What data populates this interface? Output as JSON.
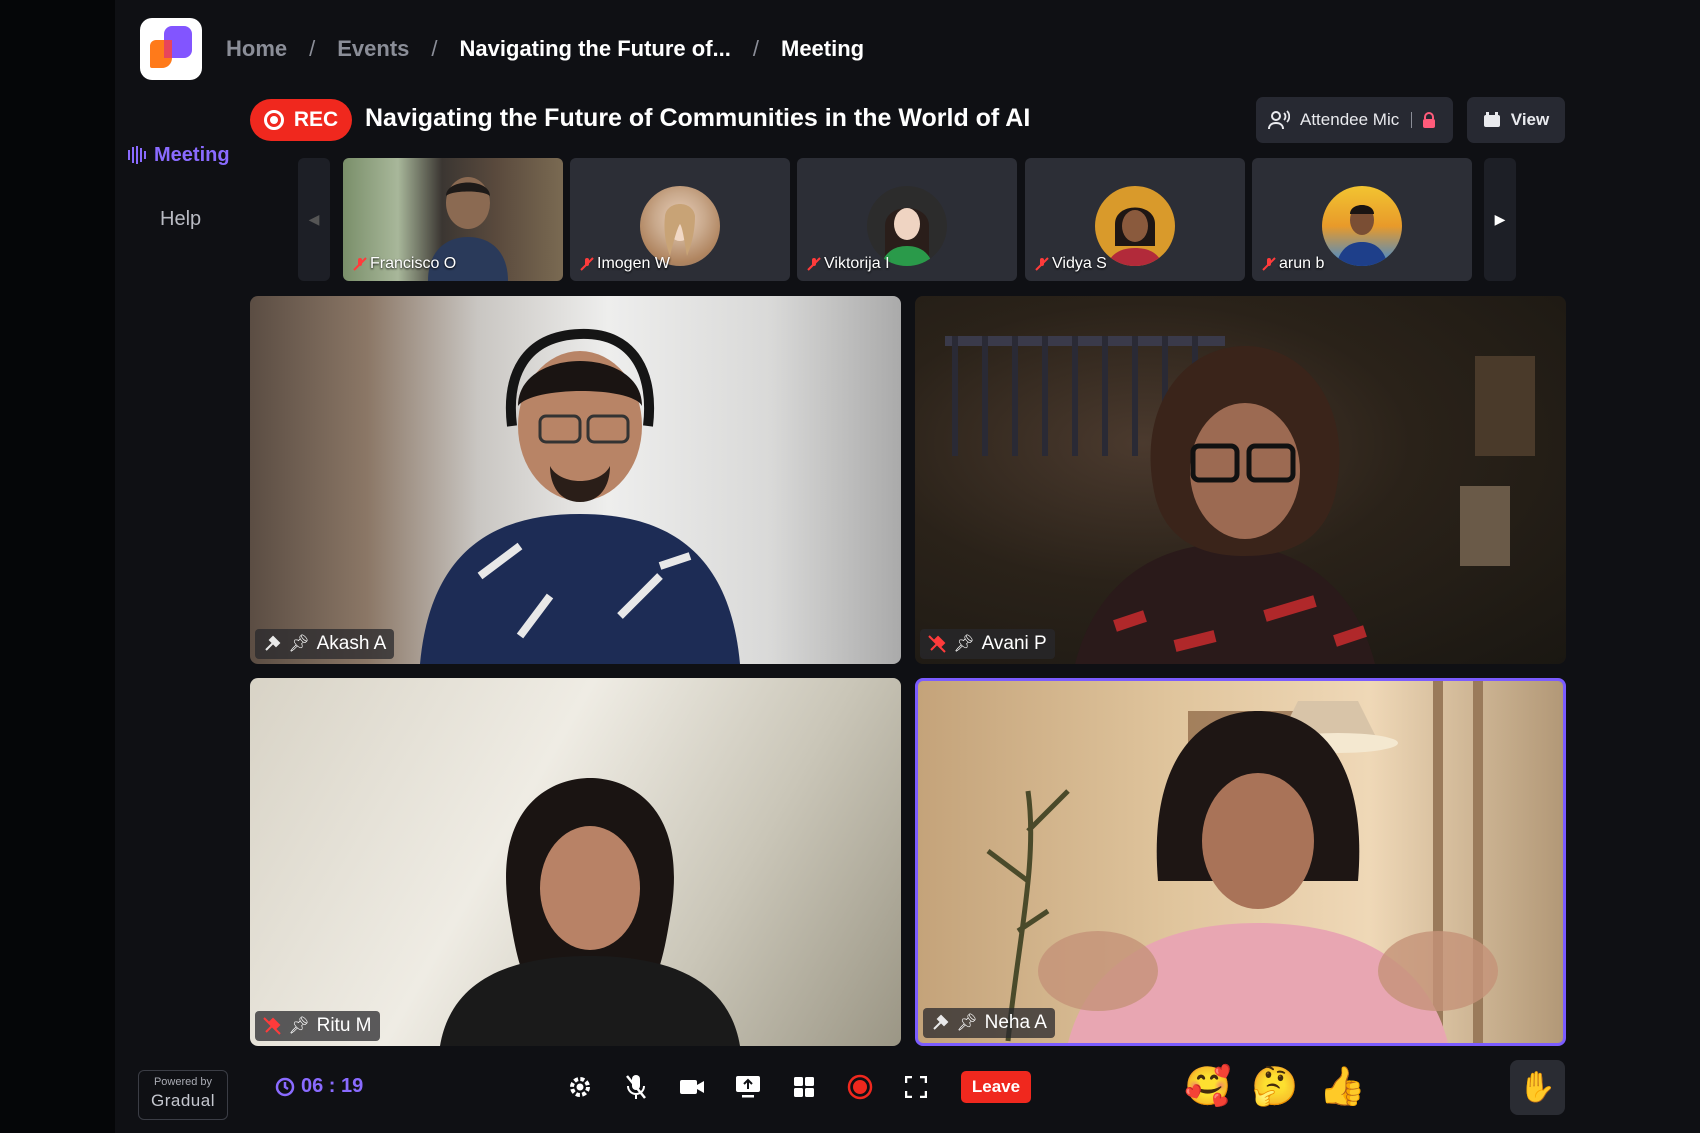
{
  "breadcrumb": {
    "home": "Home",
    "events": "Events",
    "event": "Navigating the Future of...",
    "current": "Meeting",
    "sep": "/"
  },
  "sidebar": {
    "meeting": "Meeting",
    "help": "Help"
  },
  "header": {
    "rec_label": "REC",
    "title": "Navigating the Future of Communities in the World of AI",
    "attendee_mic": "Attendee Mic",
    "view": "View"
  },
  "thumbnails": [
    {
      "name": "Francisco O"
    },
    {
      "name": "Imogen W"
    },
    {
      "name": "Viktorija I"
    },
    {
      "name": "Vidya S"
    },
    {
      "name": "arun b"
    }
  ],
  "tiles": [
    {
      "name": "Akash A"
    },
    {
      "name": "Avani P"
    },
    {
      "name": "Ritu M"
    },
    {
      "name": "Neha A"
    }
  ],
  "footer": {
    "powered_by": "Powered by",
    "brand": "Gradual",
    "timer": "06 : 19",
    "leave": "Leave",
    "reactions": [
      "🥰",
      "🤔",
      "👍"
    ],
    "raise_hand": "✋"
  },
  "colors": {
    "accent": "#8a6bff",
    "danger": "#f0281e",
    "background": "#0f1014"
  }
}
